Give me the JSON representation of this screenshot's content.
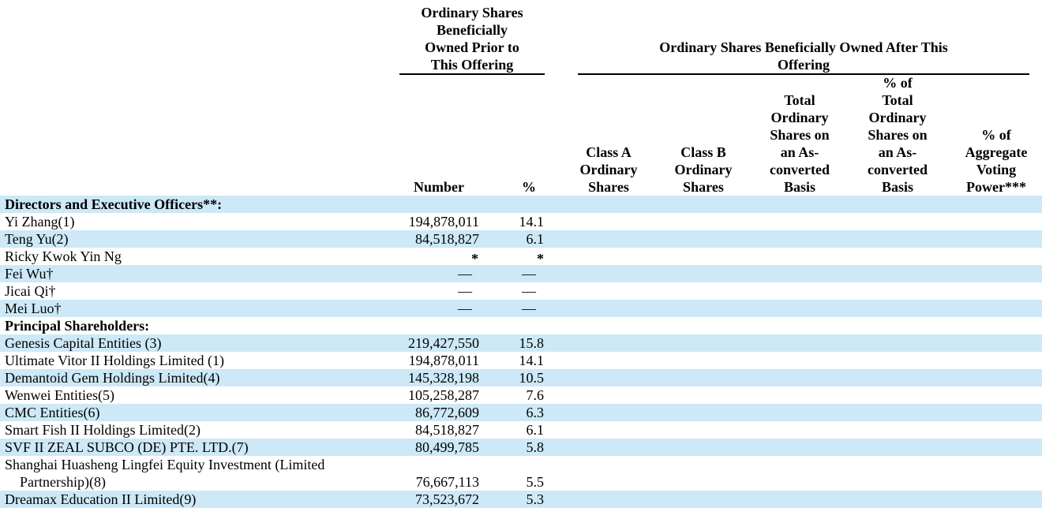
{
  "headers": {
    "prior_group": [
      "Ordinary Shares",
      "Beneficially",
      "Owned Prior to",
      "This Offering"
    ],
    "after_group": [
      "Ordinary Shares Beneficially Owned After This",
      "Offering"
    ],
    "number": "Number",
    "percent": "%",
    "class_a": [
      "Class A",
      "Ordinary",
      "Shares"
    ],
    "class_b": [
      "Class B",
      "Ordinary",
      "Shares"
    ],
    "total_converted": [
      "Total",
      "Ordinary",
      "Shares on",
      "an As-",
      "converted",
      "Basis"
    ],
    "pct_total_converted": [
      "% of",
      "Total",
      "Ordinary",
      "Shares on",
      "an As-",
      "converted",
      "Basis"
    ],
    "pct_voting": [
      "% of",
      "Aggregate",
      "Voting",
      "Power***"
    ]
  },
  "rows": [
    {
      "label": "Directors and Executive Officers**:",
      "section": true,
      "shade": true
    },
    {
      "label": "Yi Zhang(1)",
      "number": "194,878,011",
      "percent": "14.1",
      "shade": false
    },
    {
      "label": "Teng Yu(2)",
      "number": "84,518,827",
      "percent": "6.1",
      "shade": true
    },
    {
      "label": "Ricky Kwok Yin Ng",
      "number": "*",
      "percent": "*",
      "shade": false,
      "star": true
    },
    {
      "label": "Fei Wu†",
      "number": "—",
      "percent": "—",
      "shade": true,
      "dash": true
    },
    {
      "label": "Jicai Qi†",
      "number": "—",
      "percent": "—",
      "shade": false,
      "dash": true
    },
    {
      "label": "Mei Luo†",
      "number": "—",
      "percent": "—",
      "shade": true,
      "dash": true
    },
    {
      "label": "Principal Shareholders:",
      "section": true,
      "shade": false
    },
    {
      "label": "Genesis Capital Entities (3)",
      "number": "219,427,550",
      "percent": "15.8",
      "shade": true
    },
    {
      "label": "Ultimate Vitor II Holdings Limited (1)",
      "number": "194,878,011",
      "percent": "14.1",
      "shade": false
    },
    {
      "label": "Demantoid Gem Holdings Limited(4)",
      "number": "145,328,198",
      "percent": "10.5",
      "shade": true
    },
    {
      "label": "Wenwei Entities(5)",
      "number": "105,258,287",
      "percent": "7.6",
      "shade": false
    },
    {
      "label": "CMC Entities(6)",
      "number": "86,772,609",
      "percent": "6.3",
      "shade": true
    },
    {
      "label": "Smart Fish II Holdings Limited(2)",
      "number": "84,518,827",
      "percent": "6.1",
      "shade": false
    },
    {
      "label": "SVF II ZEAL SUBCO (DE) PTE. LTD.(7)",
      "number": "80,499,785",
      "percent": "5.8",
      "shade": true
    },
    {
      "label": "Shanghai Huasheng Lingfei Equity Investment (Limited",
      "label2": "Partnership)(8)",
      "number": "76,667,113",
      "percent": "5.5",
      "shade": false,
      "tall": true
    },
    {
      "label": "Dreamax Education II Limited(9)",
      "number": "73,523,672",
      "percent": "5.3",
      "shade": true
    }
  ]
}
